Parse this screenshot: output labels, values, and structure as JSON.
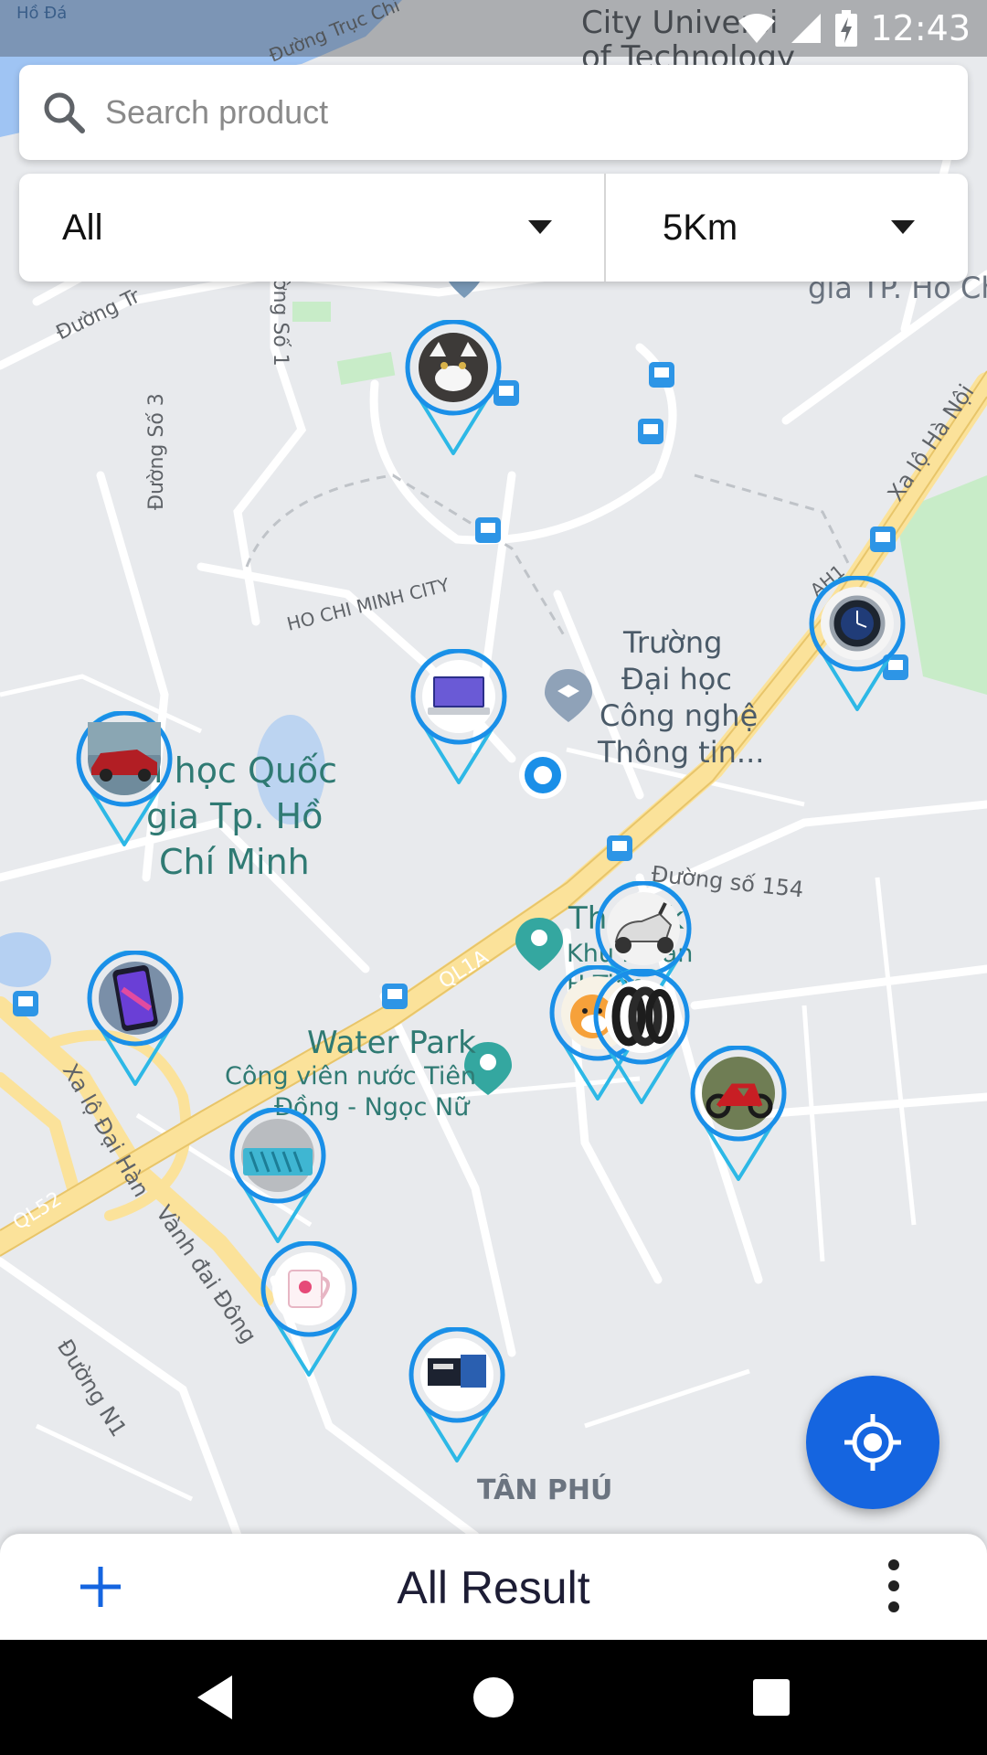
{
  "colors": {
    "accent": "#1565e0",
    "pin_ring": "#1a8fe8",
    "pin_point": "#2db8e6",
    "map_bg": "#e8eaed",
    "road": "#ffffff",
    "highway": "#fbe29a",
    "water": "#9fc4f3",
    "park": "#c8ecc8"
  },
  "status_bar": {
    "time": "12:43",
    "icons": [
      "wifi-icon",
      "cell-signal-icon",
      "battery-charging-icon"
    ]
  },
  "search": {
    "placeholder": "Search product",
    "value": ""
  },
  "filters": {
    "category": "All",
    "distance": "5Km"
  },
  "map": {
    "labels": {
      "university_cut": "City Universi",
      "university_cut2": "of Technology",
      "ho_da": "Hồ Đá",
      "duong_truc": "Đường Trục Chi",
      "duong_so3": "Đường Số 3",
      "duong_so1": "ờng Số 1",
      "duong_tr": "Đường Tr",
      "hcmc": "HO CHI MINH CITY",
      "truong1": "Trường",
      "truong2": "Đại học",
      "truong3": "Công nghệ",
      "truong4": "Thông tin...",
      "dhqg1": "i học Quốc",
      "dhqg2": "gia Tp. Hồ",
      "dhqg3": "Chí Minh",
      "duong154": "Đường số 154",
      "theme_park": "Th      Park",
      "theme_sub1": "Khu        n Văn",
      "theme_sub2": "H         Tiên",
      "water_park": "Water Park",
      "water_sub1": "Công viên nước Tiên",
      "water_sub2": "Đồng - Ngọc Nữ",
      "ql1a": "QL1A",
      "ql52": "QL52",
      "xa_lo_dai_han": "Xa lộ Đại Hàn",
      "vanh_dai_dong": "Vành đai Đông",
      "xa_lo_ha_noi": "Xa lộ Hà Nội",
      "duong_n1": "Đường N1",
      "tan_phu": "TÂN PHÚ",
      "gia_tp": "gia TP. Hồ Ch",
      "ah1": "AH1"
    }
  },
  "pins": [
    {
      "id": "cat",
      "product_icon": "cat-photo-icon"
    },
    {
      "id": "watch",
      "product_icon": "watch-photo-icon"
    },
    {
      "id": "laptop",
      "product_icon": "laptop-photo-icon"
    },
    {
      "id": "car",
      "product_icon": "car-photo-icon"
    },
    {
      "id": "phone",
      "product_icon": "phone-photo-icon"
    },
    {
      "id": "scooter",
      "product_icon": "scooter-photo-icon"
    },
    {
      "id": "toy",
      "product_icon": "toy-photo-icon"
    },
    {
      "id": "tires",
      "product_icon": "tires-photo-icon"
    },
    {
      "id": "motorbike",
      "product_icon": "motorbike-photo-icon"
    },
    {
      "id": "bag",
      "product_icon": "bag-photo-icon"
    },
    {
      "id": "mug",
      "product_icon": "mug-photo-icon"
    },
    {
      "id": "box",
      "product_icon": "box-photo-icon"
    }
  ],
  "bottom_bar": {
    "title": "All Result"
  }
}
